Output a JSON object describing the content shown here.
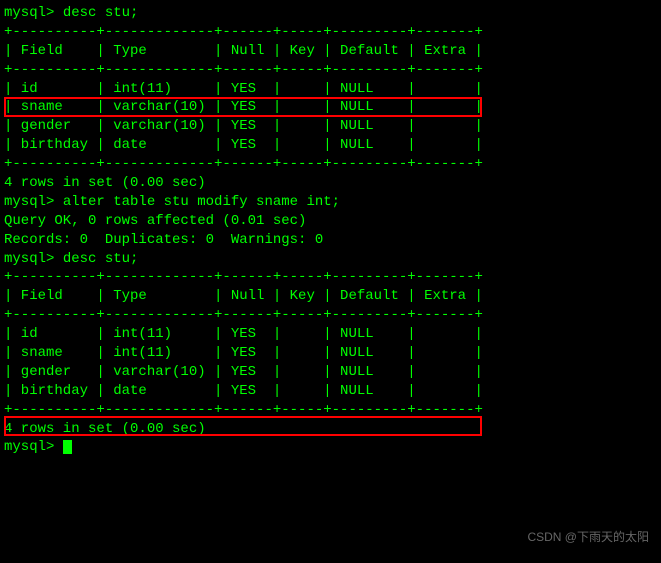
{
  "prompt": "mysql> ",
  "commands": {
    "desc1": "desc stu;",
    "alter": "alter table stu modify sname int;",
    "desc2": "desc stu;"
  },
  "separator": "+----------+-------------+------+-----+---------+-------+",
  "header": "| Field    | Type        | Null | Key | Default | Extra |",
  "table1": {
    "rows": [
      "| id       | int(11)     | YES  |     | NULL    |       |",
      "| sname    | varchar(10) | YES  |     | NULL    |       |",
      "| gender   | varchar(10) | YES  |     | NULL    |       |",
      "| birthday | date        | YES  |     | NULL    |       |"
    ]
  },
  "table2": {
    "rows": [
      "| id       | int(11)     | YES  |     | NULL    |       |",
      "| sname    | int(11)     | YES  |     | NULL    |       |",
      "| gender   | varchar(10) | YES  |     | NULL    |       |",
      "| birthday | date        | YES  |     | NULL    |       |"
    ]
  },
  "result_rows": "4 rows in set (0.00 sec)",
  "query_ok": "Query OK, 0 rows affected (0.01 sec)",
  "records": "Records: 0  Duplicates: 0  Warnings: 0",
  "blank": "",
  "watermark": "CSDN @下雨天的太阳"
}
